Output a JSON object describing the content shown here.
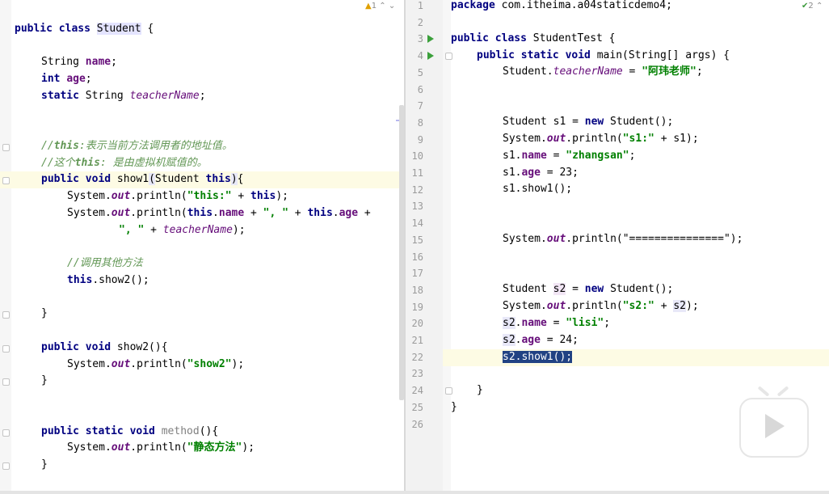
{
  "left_editor": {
    "inspection": {
      "warnings": "1",
      "up": "⌃",
      "down": "⌄"
    },
    "code": {
      "class_kw": "public class ",
      "class_name": "Student",
      "class_open": " {",
      "f1_type": "String ",
      "f1_name": "name",
      "f1_end": ";",
      "f2_type": "int ",
      "f2_name": "age",
      "f2_end": ";",
      "f3_static": "static ",
      "f3_type": "String ",
      "f3_name": "teacherName",
      "f3_end": ";",
      "c1_a": "//",
      "c1_kw": "this",
      "c1_b": ":表示当前方法调用者的地址值。",
      "c2_a": "//这个",
      "c2_kw": "this",
      "c2_b": ": 是由虚拟机赋值的。",
      "m1_mod": "public void ",
      "m1_name": "show1",
      "m1_paren": "(",
      "m1_ptype": "Student ",
      "m1_this": "this",
      "m1_close": ")",
      "m1_brace": "{",
      "p1_a": "System.",
      "p1_out": "out",
      "p1_b": ".println(",
      "p1_str": "\"this:\"",
      "p1_c": " + ",
      "p1_this": "this",
      "p1_d": ");",
      "p2_a": "System.",
      "p2_out": "out",
      "p2_b": ".println(",
      "p2_this1": "this",
      "p2_dot1": ".",
      "p2_name": "name",
      "p2_c": " + ",
      "p2_str": "\", \"",
      "p2_d": " + ",
      "p2_this2": "this",
      "p2_dot2": ".",
      "p2_age": "age",
      "p2_e": " +",
      "p3_str": "\", \"",
      "p3_b": " + ",
      "p3_tn": "teacherName",
      "p3_c": ");",
      "c3": "//调用其他方法",
      "call_this": "this",
      "call_rest": ".show2();",
      "close1": "}",
      "m2_mod": "public void ",
      "m2_rest": "show2(){",
      "p4_a": "System.",
      "p4_out": "out",
      "p4_b": ".println(",
      "p4_str": "\"show2\"",
      "p4_c": ");",
      "close2": "}",
      "m3_mod": "public static void ",
      "m3_name": "method",
      "m3_rest": "(){",
      "p5_a": "System.",
      "p5_out": "out",
      "p5_b": ".println(",
      "p5_str": "\"静态方法\"",
      "p5_c": ");",
      "close3": "}"
    }
  },
  "right_editor": {
    "inspection": {
      "ok": "2",
      "up": "⌃"
    },
    "line_numbers": [
      "1",
      "2",
      "3",
      "4",
      "5",
      "6",
      "7",
      "8",
      "9",
      "10",
      "11",
      "12",
      "13",
      "14",
      "15",
      "16",
      "17",
      "18",
      "19",
      "20",
      "21",
      "22",
      "23",
      "24",
      "25",
      "26"
    ],
    "code": {
      "pkg_kw": "package ",
      "pkg_name": "com.itheima.a04staticdemo4;",
      "cls_kw": "public class ",
      "cls_name": "StudentTest {",
      "main_kw": "public static void ",
      "main_rest": "main(String[] args) {",
      "l5_a": "Student.",
      "l5_tn": "teacherName",
      "l5_b": " = ",
      "l5_str": "\"阿玮老师\"",
      "l5_c": ";",
      "l8_a": "Student s1 = ",
      "l8_new": "new",
      "l8_b": " Student();",
      "l9_a": "System.",
      "l9_out": "out",
      "l9_b": ".println(",
      "l9_str": "\"s1:\"",
      "l9_c": " + s1);",
      "l10_a": "s1.",
      "l10_name": "name",
      "l10_b": " = ",
      "l10_str": "\"zhangsan\"",
      "l10_c": ";",
      "l11_a": "s1.",
      "l11_age": "age",
      "l11_b": " = 23;",
      "l12": "s1.show1();",
      "l15_a": "System.",
      "l15_out": "out",
      "l15_b": ".println(\"===============\");",
      "l18_a": "Student ",
      "l18_s2": "s2",
      "l18_b": " = ",
      "l18_new": "new",
      "l18_c": " Student();",
      "l19_a": "System.",
      "l19_out": "out",
      "l19_b": ".println(",
      "l19_str": "\"s2:\"",
      "l19_c": " + ",
      "l19_s2": "s2",
      "l19_d": ");",
      "l20_s2": "s2",
      "l20_a": ".",
      "l20_name": "name",
      "l20_b": " = ",
      "l20_str": "\"lisi\"",
      "l20_c": ";",
      "l21_s2": "s2",
      "l21_a": ".",
      "l21_age": "age",
      "l21_b": " = 24;",
      "l22": "s2.show1();",
      "l24": "}",
      "l25": "}"
    }
  },
  "colors": {
    "keyword": "#000080",
    "field": "#660e7a",
    "string": "#008000",
    "comment": "#629755",
    "selection": "#214283",
    "run_icon": "#3ba03b"
  },
  "icons": {
    "run": "run-gutter-icon",
    "video": "play-video-icon"
  }
}
